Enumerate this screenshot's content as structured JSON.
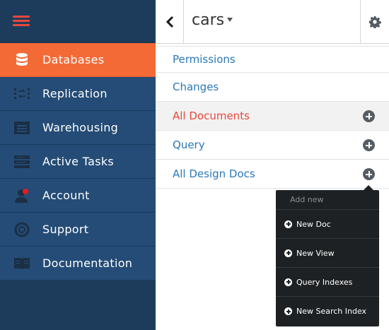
{
  "sidebar": {
    "menu_icon": "hamburger-icon",
    "items": [
      {
        "label": "Databases",
        "icon": "database-icon",
        "active": true
      },
      {
        "label": "Replication",
        "icon": "replication-icon",
        "active": false
      },
      {
        "label": "Warehousing",
        "icon": "warehouse-icon",
        "active": false
      },
      {
        "label": "Active Tasks",
        "icon": "tasks-icon",
        "active": false
      },
      {
        "label": "Account",
        "icon": "user-icon",
        "active": false
      },
      {
        "label": "Support",
        "icon": "lifebuoy-icon",
        "active": false
      },
      {
        "label": "Documentation",
        "icon": "book-icon",
        "active": false
      }
    ]
  },
  "topbar": {
    "back_icon": "chevron-left-icon",
    "database_name": "cars",
    "caret_icon": "caret-down-icon",
    "settings_icon": "gear-icon"
  },
  "subnav": {
    "items": [
      {
        "label": "Permissions",
        "has_add": false,
        "active": false
      },
      {
        "label": "Changes",
        "has_add": false,
        "active": false
      },
      {
        "label": "All Documents",
        "has_add": true,
        "active": true
      },
      {
        "label": "Query",
        "has_add": true,
        "active": false
      },
      {
        "label": "All Design Docs",
        "has_add": true,
        "active": false
      }
    ]
  },
  "dropdown": {
    "header": "Add new",
    "items": [
      {
        "label": "New Doc"
      },
      {
        "label": "New View"
      },
      {
        "label": "Query Indexes"
      },
      {
        "label": "New Search Index"
      }
    ]
  },
  "colors": {
    "sidebar_bg": "#1d3c5c",
    "nav_item_bg": "#244c76",
    "active_orange": "#f46a37",
    "link_blue": "#2a78b8",
    "active_red": "#e8473a",
    "dropdown_bg": "#1e2123"
  }
}
